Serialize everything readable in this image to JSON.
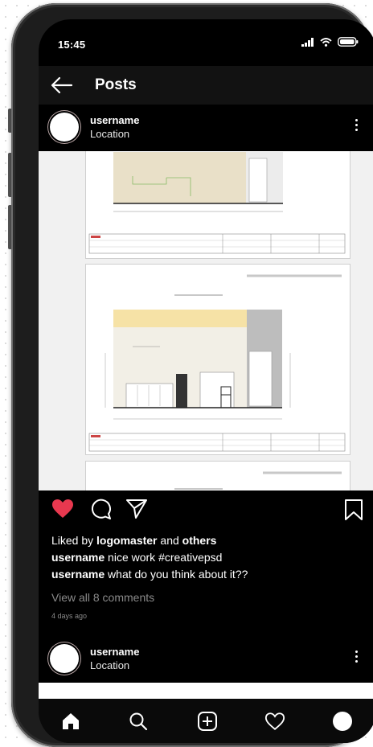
{
  "status_bar": {
    "time": "15:45",
    "icons": [
      "signal-icon",
      "wifi-icon",
      "battery-icon"
    ]
  },
  "header": {
    "title": "Posts",
    "back_icon": "back-arrow-icon"
  },
  "post": {
    "username": "username",
    "location": "Location",
    "image_description_icon": "architectural-drawing-image",
    "liked_by_prefix": "Liked by ",
    "liked_by_user": "logomaster",
    "liked_by_and": " and ",
    "liked_by_others": "others",
    "caption_user": "username",
    "caption_text": " nice work #creativepsd",
    "comment_user": "username",
    "comment_text": " what do you think about it??",
    "view_all": "View all 8 comments",
    "time_ago": "4 days ago"
  },
  "post2": {
    "username": "username",
    "location": "Location"
  },
  "nav": {
    "items": [
      "home-icon",
      "search-icon",
      "add-icon",
      "heart-icon",
      "profile-icon"
    ]
  },
  "colors": {
    "like": "#e8384f",
    "background": "#000000",
    "header": "#121212"
  }
}
